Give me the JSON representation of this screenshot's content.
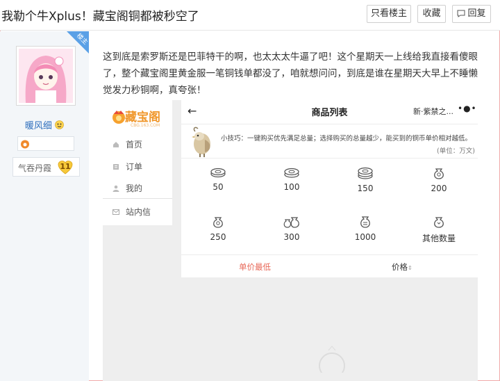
{
  "thread": {
    "title": "我勒个牛Xplus！藏宝阁铜都被秒空了",
    "buttons": {
      "only_op": "只看楼主",
      "favorite": "收藏",
      "reply": "回复"
    }
  },
  "author": {
    "op_badge": "楼主",
    "username": "暖风细",
    "rank_name": "气吞丹霞",
    "rank_level": "11"
  },
  "post": {
    "text": "这到底是索罗斯还是巴菲特干的啊，也太太太牛逼了吧！这个星期天一上线给我直接看傻眼了，整个藏宝阁里黄金服一笔铜钱单都没了，咱就想问问，到底是谁在星期天大早上不睡懒觉发力秒铜啊，真夸张！"
  },
  "screenshot": {
    "logo_text": "藏宝阁",
    "logo_sub": "CBG.163.COM",
    "nav": [
      "首页",
      "订单",
      "我的",
      "站内信"
    ],
    "shop_title": "商品列表",
    "server": "新·紫禁之...",
    "more": "•●•",
    "tip": "小技巧：一键购买优先满足总量；选择购买的总量越少，能买到的铜币单价相对越低。",
    "unit": "(单位：万文)",
    "amounts": [
      "50",
      "100",
      "150",
      "200",
      "250",
      "300",
      "1000",
      "其他数量"
    ],
    "sort_left": "单价最低",
    "sort_right": "价格",
    "sort_arrow": "⇕"
  },
  "colors": {
    "accent_blue": "#5aa0e6",
    "username_blue": "#2f6fbd",
    "sort_red": "#e86a5a",
    "logo_orange": "#f0972b",
    "frame_border": "#f1a9a9"
  },
  "icons": [
    "reply-bubble-icon",
    "level-icon",
    "rank-heart-icon",
    "avatar-image",
    "cbg-logo-icon",
    "home-icon",
    "order-icon",
    "user-icon",
    "mail-icon",
    "back-arrow-icon",
    "bird-mascot-icon",
    "coin-pile-icon",
    "coin-bag-icon"
  ]
}
